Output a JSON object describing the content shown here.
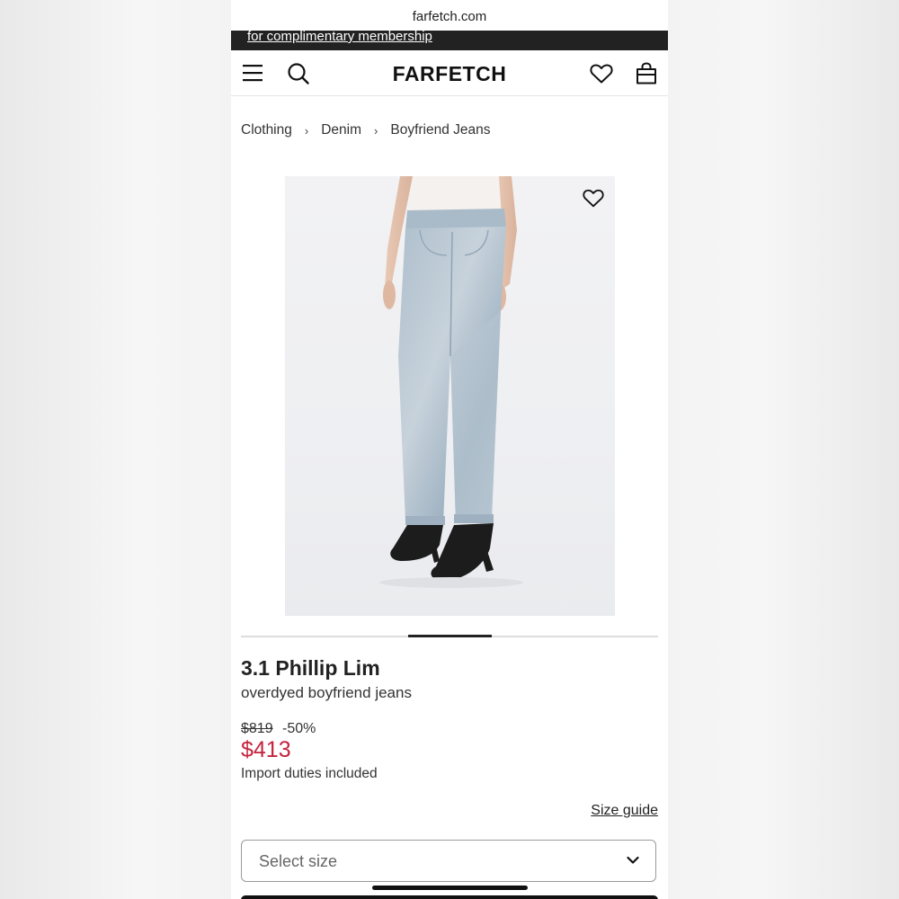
{
  "browser": {
    "url": "farfetch.com"
  },
  "promo": {
    "text": "for complimentary membership"
  },
  "header": {
    "logo": "FARFETCH",
    "icons": [
      "menu-icon",
      "search-icon",
      "heart-icon",
      "shopping-bag-icon"
    ]
  },
  "breadcrumb": {
    "items": [
      "Clothing",
      "Denim",
      "Boyfriend Jeans"
    ],
    "separator": "›"
  },
  "gallery": {
    "image_alt": "light blue acid-wash boyfriend jeans with black heeled mules",
    "wishlist_icon": "heart-outline-icon",
    "active_index": 2,
    "total": 5
  },
  "product": {
    "brand": "3.1 Phillip Lim",
    "name": "overdyed boyfriend jeans",
    "original_price": "$819",
    "discount": "-50%",
    "sale_price": "$413",
    "duties_note": "Import duties included",
    "size_guide_label": "Size guide",
    "size_placeholder": "Select size"
  },
  "colors": {
    "sale": "#c4233e",
    "promo_bar": "#222222",
    "text": "#222222"
  }
}
